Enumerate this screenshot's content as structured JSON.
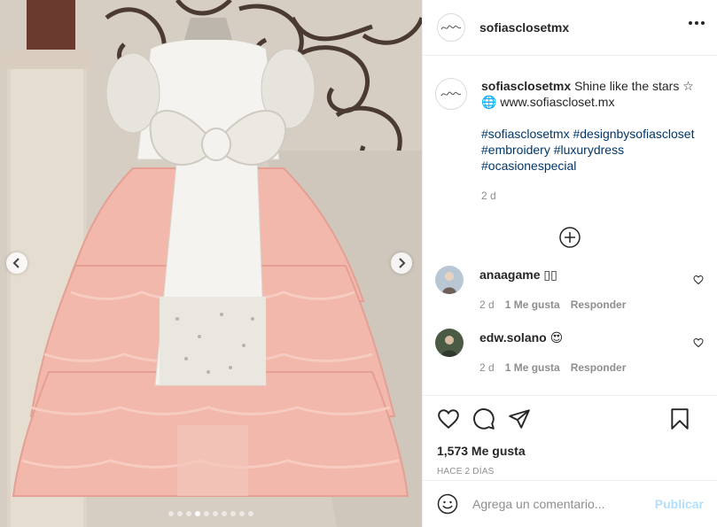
{
  "post": {
    "username": "sofiasclosetmx",
    "avatar_text": "Sofia's Closet"
  },
  "caption": {
    "username": "sofiasclosetmx",
    "text": "Shine like the stars ☆",
    "globe": "🌐",
    "link": "www.sofiascloset.mx",
    "hashtags_line1": "#sofiasclosetmx #designbysofiascloset",
    "hashtags_line2": "#embroidery #luxurydress",
    "hashtags_line3": "#ocasionespecial",
    "time": "2 d"
  },
  "comments": [
    {
      "username": "anaagame",
      "text_suffix": "▯▯",
      "time": "2 d",
      "likes": "1 Me gusta",
      "reply": "Responder"
    },
    {
      "username": "edw.solano",
      "text_suffix": "😍",
      "time": "2 d",
      "likes": "1 Me gusta",
      "reply": "Responder"
    }
  ],
  "actions": {
    "likes_count": "1,573 Me gusta",
    "posted_ago": "HACE 2 DÍAS"
  },
  "add_comment": {
    "placeholder": "Agrega un comentario...",
    "publish_label": "Publicar"
  },
  "carousel": {
    "slides": 10,
    "active_index": 3
  },
  "colors": {
    "link_blue": "#00376b",
    "publish_blue": "#b2dffc",
    "dress_pink": "#f2b8ac",
    "dress_white": "#f4f3ef"
  }
}
